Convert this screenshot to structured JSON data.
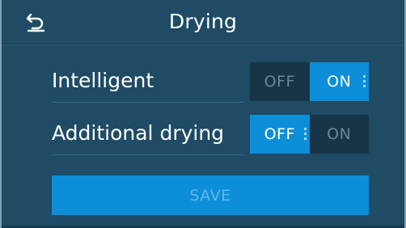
{
  "header": {
    "title": "Drying",
    "back_icon": "back-arrow-icon"
  },
  "settings": [
    {
      "label": "Intelligent",
      "off_label": "OFF",
      "on_label": "ON",
      "value": "ON"
    },
    {
      "label": "Additional drying",
      "off_label": "OFF",
      "on_label": "ON",
      "value": "OFF"
    }
  ],
  "save_label": "SAVE",
  "colors": {
    "background": "#1f4b64",
    "accent": "#0d8ed8",
    "toggle_inactive": "#163546"
  }
}
